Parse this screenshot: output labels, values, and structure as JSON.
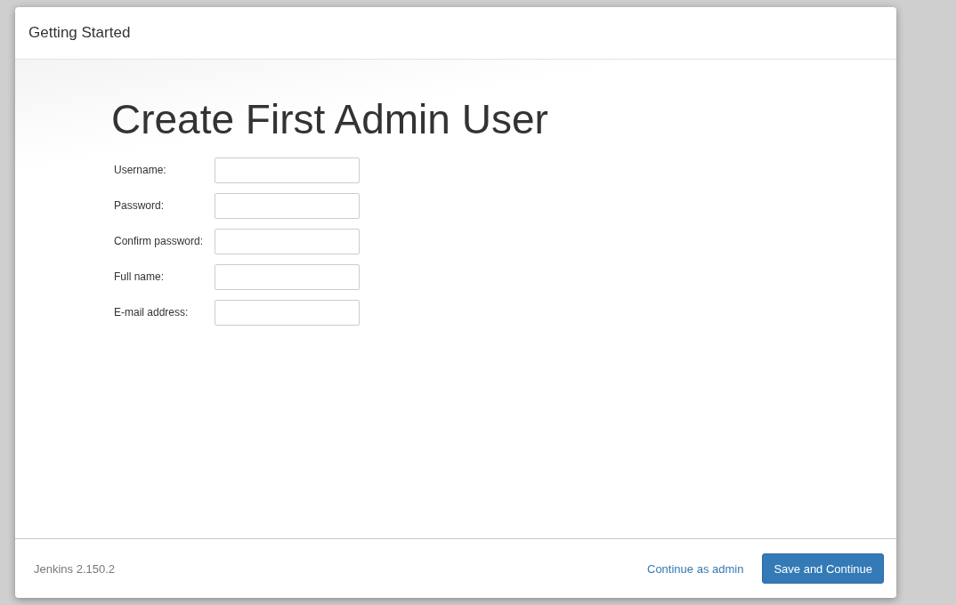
{
  "dialog": {
    "title": "Getting Started"
  },
  "heading": "Create First Admin User",
  "fields": [
    {
      "label": "Username:"
    },
    {
      "label": "Password:"
    },
    {
      "label": "Confirm password:"
    },
    {
      "label": "Full name:"
    },
    {
      "label": "E-mail address:"
    }
  ],
  "footer": {
    "version": "Jenkins 2.150.2",
    "link": "Continue as admin",
    "button": "Save and Continue"
  }
}
